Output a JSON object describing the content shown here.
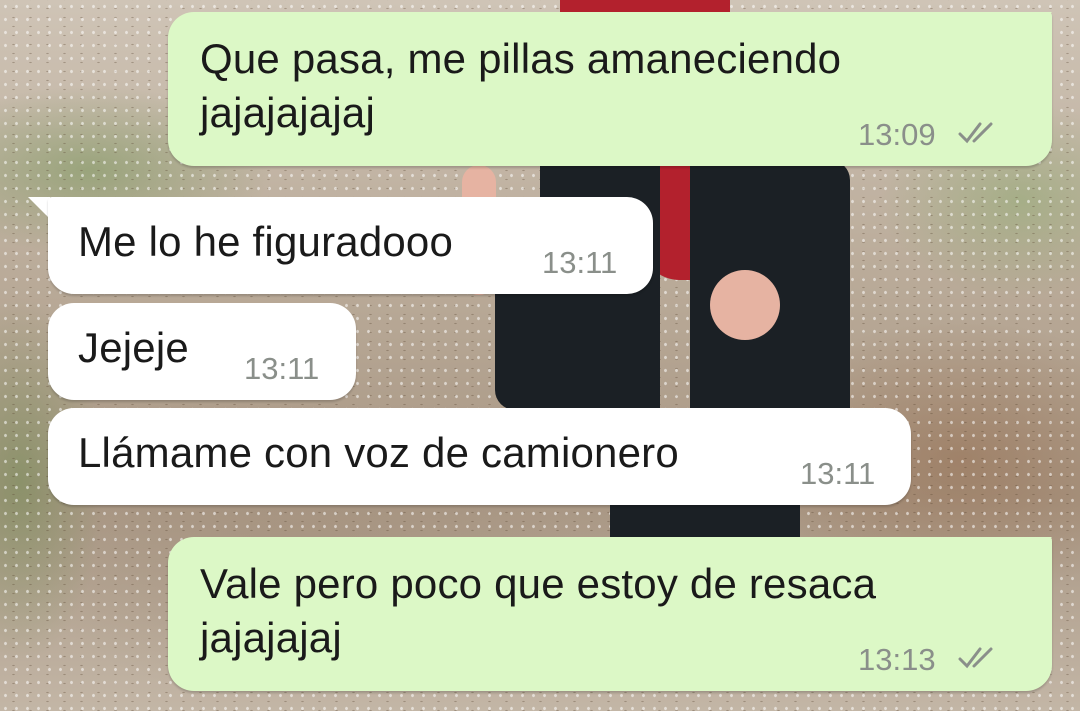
{
  "messages": [
    {
      "direction": "outgoing",
      "text": "Que pasa, me pillas amaneciendo\njajajajajaj",
      "time": "13:09",
      "status_icon": "double-check-icon"
    },
    {
      "direction": "incoming",
      "text": "Me lo he figuradooo",
      "time": "13:11"
    },
    {
      "direction": "incoming",
      "text": "Jejeje",
      "time": "13:11"
    },
    {
      "direction": "incoming",
      "text": "Llámame con voz de camionero",
      "time": "13:11"
    },
    {
      "direction": "outgoing",
      "text": "Vale pero poco que estoy de resaca\njajajajaj",
      "time": "13:13",
      "status_icon": "double-check-icon"
    }
  ],
  "colors": {
    "outgoing_bubble": "#dcf8c6",
    "incoming_bubble": "#ffffff",
    "text": "#1a1a1a",
    "timestamp": "#8a8f8a",
    "ticks": "#8a8f8a"
  }
}
